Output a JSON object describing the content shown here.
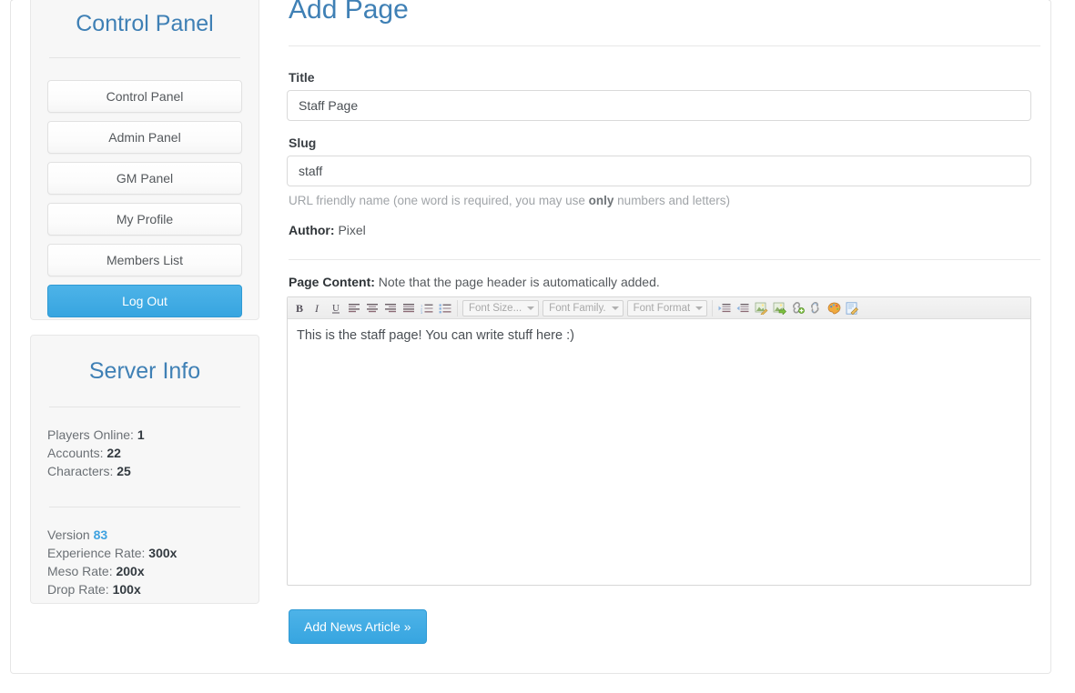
{
  "sidebar": {
    "control_panel": {
      "title": "Control Panel",
      "buttons": [
        {
          "label": "Control Panel",
          "name": "control-panel",
          "primary": false
        },
        {
          "label": "Admin Panel",
          "name": "admin-panel",
          "primary": false
        },
        {
          "label": "GM Panel",
          "name": "gm-panel",
          "primary": false
        },
        {
          "label": "My Profile",
          "name": "my-profile",
          "primary": false
        },
        {
          "label": "Members List",
          "name": "members-list",
          "primary": false
        },
        {
          "label": "Log Out",
          "name": "log-out",
          "primary": true
        }
      ]
    },
    "server_info": {
      "title": "Server Info",
      "players_online_label": "Players Online:",
      "players_online_value": "1",
      "accounts_label": "Accounts:",
      "accounts_value": "22",
      "characters_label": "Characters:",
      "characters_value": "25",
      "version_label": "Version",
      "version_value": "83",
      "experience_label": "Experience Rate:",
      "experience_value": "300x",
      "meso_label": "Meso Rate:",
      "meso_value": "200x",
      "drop_label": "Drop Rate:",
      "drop_value": "100x"
    }
  },
  "main": {
    "page_title": "Add Page",
    "title_field": {
      "label": "Title",
      "value": "Staff Page",
      "placeholder": "Title"
    },
    "slug_field": {
      "label": "Slug",
      "value": "staff",
      "placeholder": "Slug",
      "help_prefix": "URL friendly name (one word is required, you may use ",
      "help_bold": "only",
      "help_suffix": " numbers and letters)"
    },
    "author": {
      "label": "Author:",
      "value": "Pixel"
    },
    "page_content": {
      "label": "Page Content:",
      "note": "Note that the page header is automatically added.",
      "body_text": "This is the staff page! You can write stuff here :)"
    },
    "editor_toolbar": {
      "buttons": [
        {
          "name": "bold-icon",
          "glyph": "B"
        },
        {
          "name": "italic-icon",
          "glyph": "I"
        },
        {
          "name": "underline-icon",
          "glyph": "U"
        }
      ],
      "align_buttons": [
        {
          "name": "align-left-icon"
        },
        {
          "name": "align-center-icon"
        },
        {
          "name": "align-right-icon"
        },
        {
          "name": "align-justify-icon"
        }
      ],
      "list_buttons": [
        {
          "name": "ordered-list-icon"
        },
        {
          "name": "unordered-list-icon"
        }
      ],
      "selects": [
        {
          "name": "font-size-select",
          "label": "Font Size..."
        },
        {
          "name": "font-family-select",
          "label": "Font Family."
        },
        {
          "name": "font-format-select",
          "label": "Font Format"
        }
      ],
      "indent_buttons": [
        {
          "name": "outdent-icon"
        },
        {
          "name": "indent-icon"
        }
      ],
      "media_buttons": [
        {
          "name": "edit-image-icon"
        },
        {
          "name": "insert-image-icon"
        },
        {
          "name": "insert-link-icon"
        },
        {
          "name": "unlink-icon"
        },
        {
          "name": "text-color-icon"
        },
        {
          "name": "edit-source-icon"
        }
      ]
    },
    "submit_button": "Add News Article »"
  },
  "colors": {
    "accent_blue": "#37a5e0",
    "heading_blue": "#3f80b5",
    "panel_bg": "#f7f7f7",
    "border_gray": "#e8e8e8"
  }
}
